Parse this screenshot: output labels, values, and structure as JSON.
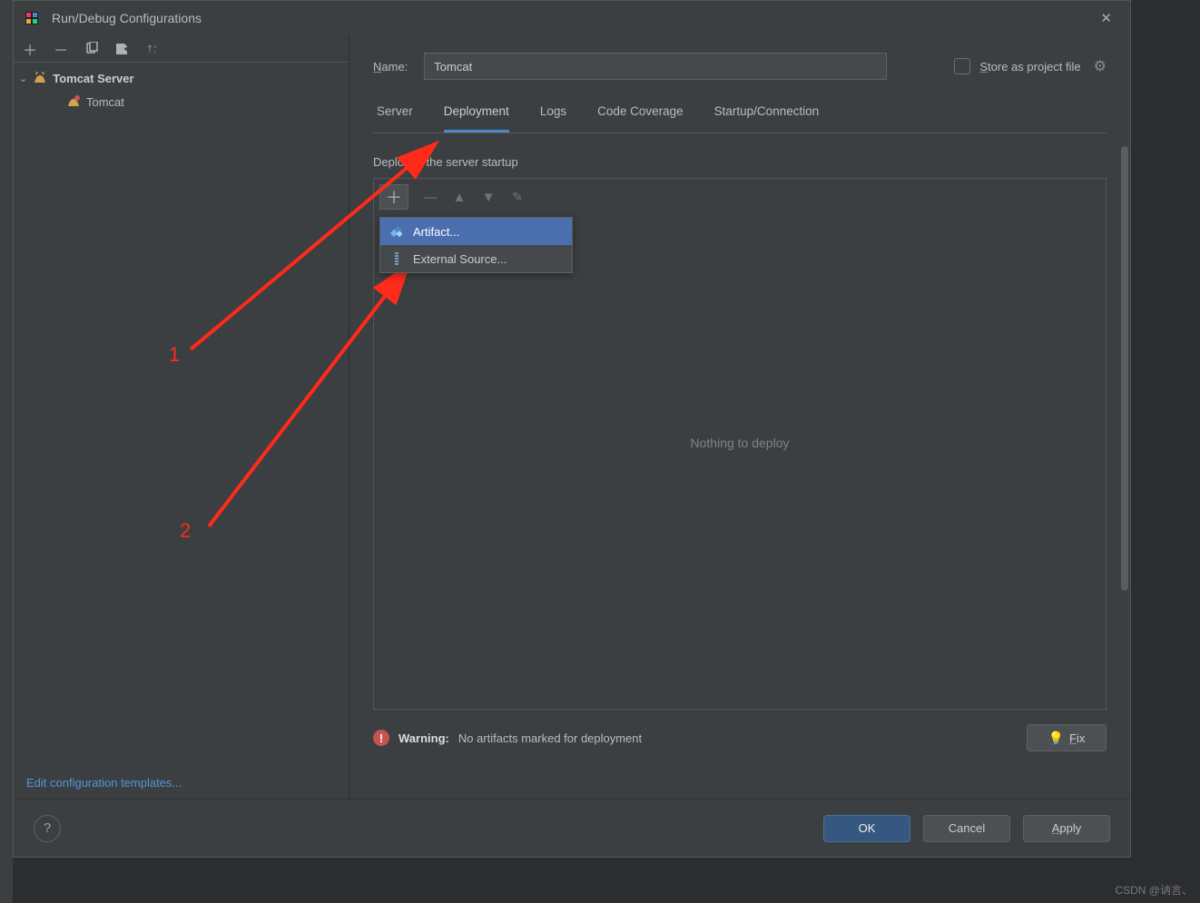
{
  "titlebar": {
    "title": "Run/Debug Configurations"
  },
  "sidebar": {
    "group_label": "Tomcat Server",
    "item_label": "Tomcat",
    "edit_templates": "Edit configuration templates..."
  },
  "main": {
    "name_label": "Name:",
    "name_value": "Tomcat",
    "store_label": "Store as project file",
    "tabs": [
      "Server",
      "Deployment",
      "Logs",
      "Code Coverage",
      "Startup/Connection"
    ],
    "active_tab": 1,
    "section_label": "Deploy at the server startup",
    "dropdown": {
      "items": [
        "Artifact...",
        "External Source..."
      ],
      "selected": 0
    },
    "empty_text": "Nothing to deploy",
    "warning_label": "Warning:",
    "warning_text": "No artifacts marked for deployment",
    "fix_label": "Fix"
  },
  "footer": {
    "ok": "OK",
    "cancel": "Cancel",
    "apply": "Apply"
  },
  "annotations": {
    "num1": "1",
    "num2": "2"
  },
  "watermark": "CSDN @讷言、"
}
